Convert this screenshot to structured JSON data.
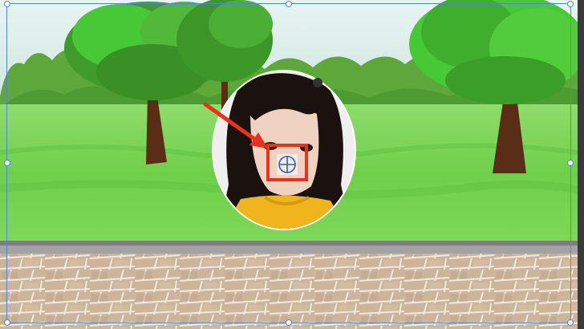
{
  "canvas": {
    "colors": {
      "sky": "#d8ebe8",
      "tree_far": "#5ea73a",
      "tree_mid": "#3f9b2a",
      "tree_bright": "#47c837",
      "grass": "#7fd35a",
      "grass_dark": "#57b83f",
      "trunk": "#5a2e16",
      "rail": "#8a8a8a",
      "paving": "#cdb59b",
      "paving_line": "#f1e9df",
      "selection": "#4f86d6",
      "annotation": "#e8321e",
      "crosshair": "#2a5fc8",
      "sweater": "#f0b51c",
      "hair": "#1b1210",
      "skin": "#f0d2c3"
    },
    "icons": {
      "crosshair": "crosshair-icon",
      "handle": "resize-handle",
      "arrow": "arrow-annotation"
    }
  }
}
